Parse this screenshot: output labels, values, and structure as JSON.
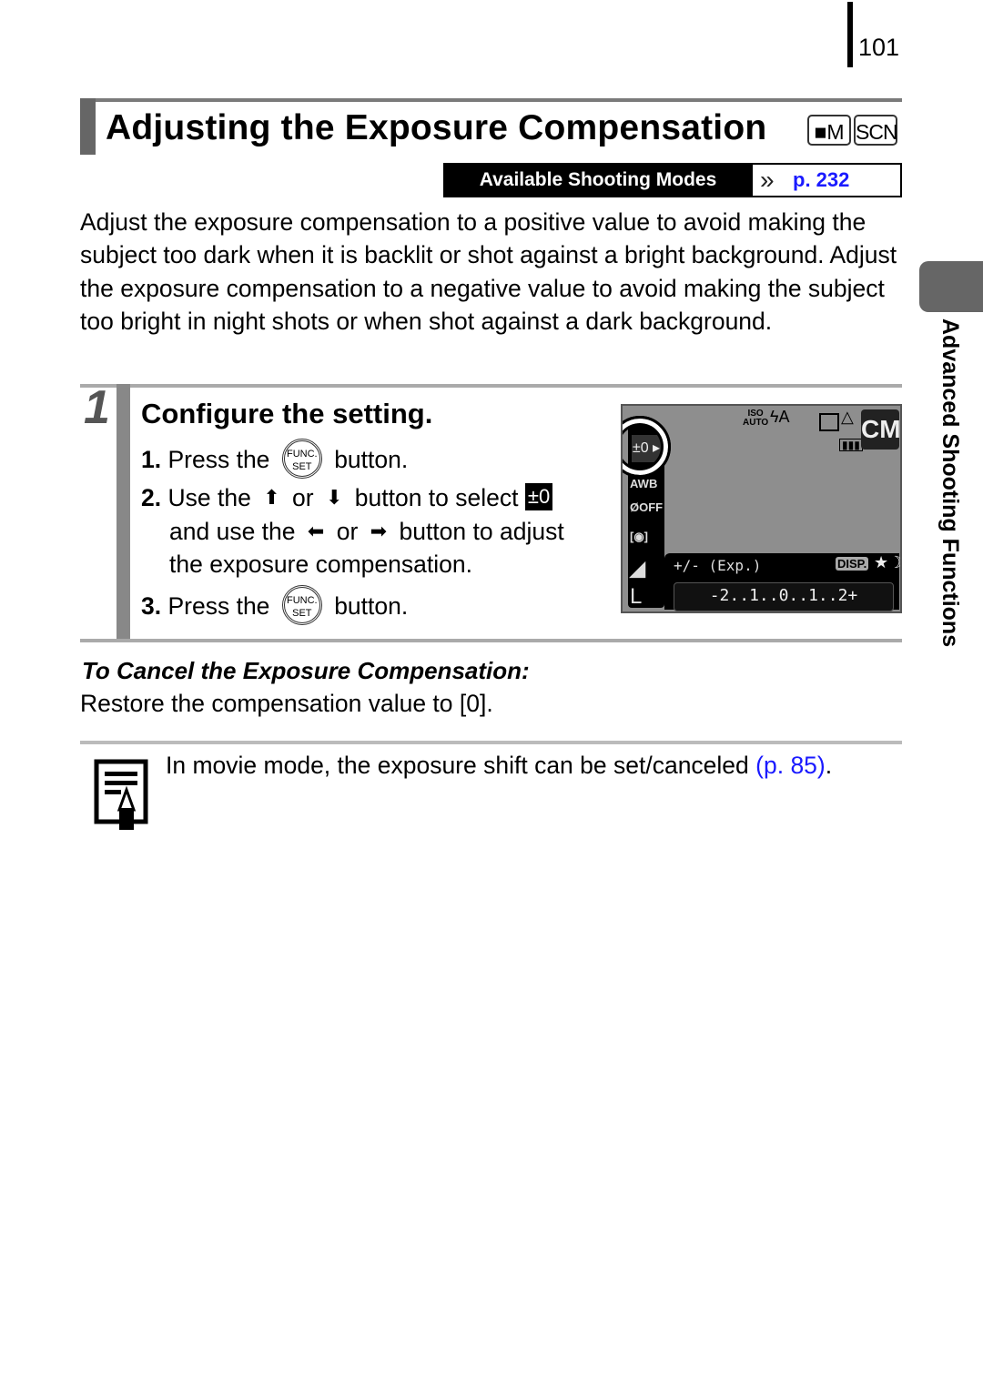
{
  "page": {
    "number": "101"
  },
  "header": {
    "title": "Adjusting the Exposure Compensation",
    "mode_badges": [
      "■M",
      "SCN"
    ],
    "available_modes_label": "Available Shooting Modes",
    "available_modes_chevron": "»",
    "available_modes_link": "p. 232"
  },
  "intro": "Adjust the exposure compensation to a positive value to avoid making the subject too dark when it is backlit or shot against a bright background. Adjust the exposure compensation to a negative value to avoid making the subject too bright in night shots or when shot against a dark background.",
  "step": {
    "number": "1",
    "heading": "Configure the setting.",
    "lines": [
      {
        "num": "1.",
        "pre": "Press the",
        "post": "button."
      },
      {
        "num": "2.",
        "pre": "Use the",
        "or": "or",
        "mid": "button to select",
        "up": "⬆",
        "down": "⬇",
        "selected_icon": "±0"
      },
      {
        "pre": "and use the",
        "or": "or",
        "post": "button to adjust",
        "left": "⬅",
        "right": "➡"
      },
      {
        "text": "the exposure compensation."
      },
      {
        "num": "3.",
        "pre": "Press the",
        "post": "button."
      }
    ],
    "func_button": {
      "top": "FUNC.",
      "bottom": "SET"
    }
  },
  "lcd": {
    "selected_item": "±0 ▸",
    "side_icons": [
      "AWB",
      "ØOFF",
      "[◉]",
      "◢",
      "L"
    ],
    "iso": [
      "ISO",
      "AUTO"
    ],
    "flash": "ϟA",
    "mode": "CM",
    "exp_label": "+/- (Exp.)",
    "disp_label": "DISP.",
    "night_icon": "★☽",
    "scale": "-2..1..0..1..2+",
    "battery": "▮▮▮"
  },
  "side_tab": {
    "label": "Advanced Shooting Functions"
  },
  "cancel": {
    "heading": "To Cancel the Exposure Compensation:",
    "body": "Restore the compensation value to [0]."
  },
  "note": {
    "text": "In movie mode, the exposure shift can be set/canceled ",
    "link": "(p. 85)",
    "end": "."
  },
  "colors": {
    "link": "#1a1aff",
    "accent_gray": "#666666"
  }
}
